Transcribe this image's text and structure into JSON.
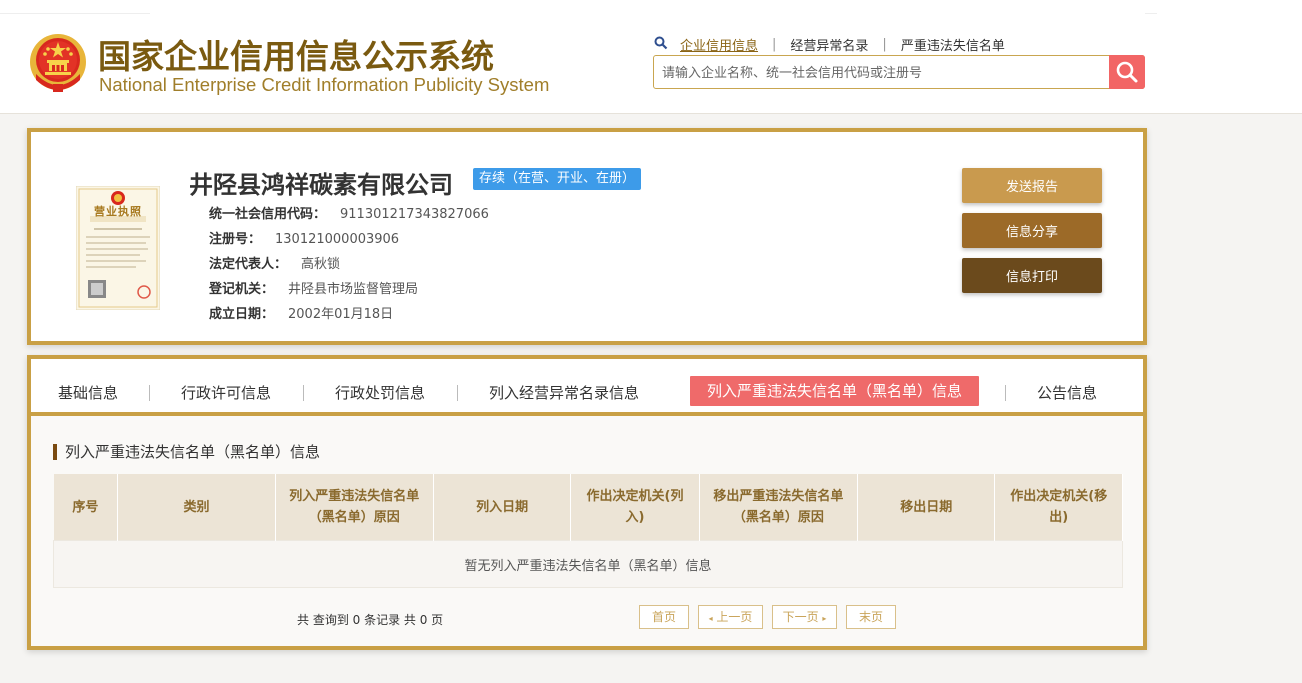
{
  "header": {
    "title_cn": "国家企业信用信息公示系统",
    "title_en": "National Enterprise Credit Information Publicity System",
    "nav": [
      {
        "label": "企业信用信息",
        "active": true
      },
      {
        "label": "经营异常名录",
        "active": false
      },
      {
        "label": "严重违法失信名单",
        "active": false
      }
    ],
    "search_placeholder": "请输入企业名称、统一社会信用代码或注册号",
    "nav_sep": "|"
  },
  "company": {
    "name": "井陉县鸿祥碳素有限公司",
    "status": "存续（在营、开业、在册）",
    "fields": [
      {
        "label": "统一社会信用代码：",
        "value": "911301217343827066"
      },
      {
        "label": "注册号：",
        "value": "130121000003906"
      },
      {
        "label": "法定代表人：",
        "value": "高秋锁"
      },
      {
        "label": "登记机关：",
        "value": "井陉县市场监督管理局"
      },
      {
        "label": "成立日期：",
        "value": "2002年01月18日"
      }
    ],
    "license_text": "营业执照"
  },
  "actions": {
    "send_report": "发送报告",
    "share": "信息分享",
    "print": "信息打印"
  },
  "tabs": [
    {
      "label": "基础信息",
      "active": false
    },
    {
      "label": "行政许可信息",
      "active": false
    },
    {
      "label": "行政处罚信息",
      "active": false
    },
    {
      "label": "列入经营异常名录信息",
      "active": false
    },
    {
      "label": "列入严重违法失信名单（黑名单）信息",
      "active": true
    },
    {
      "label": "公告信息",
      "active": false
    }
  ],
  "section": {
    "title": "列入严重违法失信名单（黑名单）信息",
    "columns": [
      "序号",
      "类别",
      "列入严重违法失信名单（黑名单）原因",
      "列入日期",
      "作出决定机关(列入)",
      "移出严重违法失信名单（黑名单）原因",
      "移出日期",
      "作出决定机关(移出)"
    ],
    "empty_text": "暂无列入严重违法失信名单（黑名单）信息"
  },
  "pagination": {
    "summary": "共 查询到 0 条记录 共 0 页",
    "first": "首页",
    "prev": "上一页",
    "next": "下一页",
    "last": "末页"
  },
  "colors": {
    "gold": "#c9a045",
    "brown_title": "#7a5a10",
    "status_blue": "#3d9be9",
    "active_tab": "#ef6a6a",
    "btn_report": "#c99a4e",
    "btn_share": "#9c6a28",
    "btn_print": "#6b4a1c",
    "search_btn": "#f26565"
  }
}
